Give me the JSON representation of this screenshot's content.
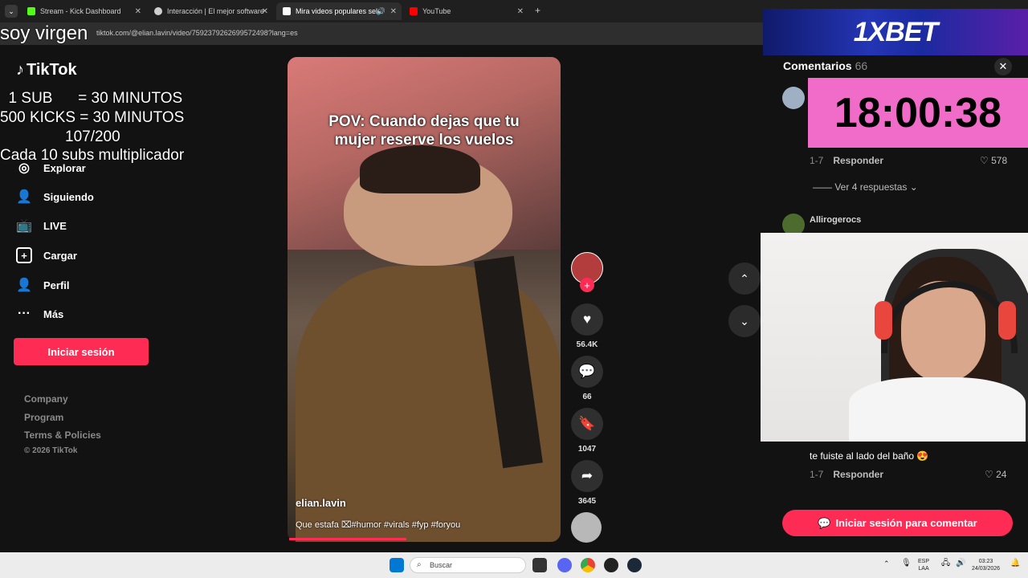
{
  "browser": {
    "tabs": [
      {
        "label": "Stream - Kick Dashboard",
        "icon": "kick-icon",
        "color": "#53fc18"
      },
      {
        "label": "Interacción | El mejor software",
        "icon": "globe-icon",
        "color": "#cfcfcf"
      },
      {
        "label": "Mira videos populares sele",
        "icon": "tiktok-icon",
        "color": "#ffffff"
      },
      {
        "label": "YouTube",
        "icon": "youtube-icon",
        "color": "#ff0000"
      }
    ],
    "new_tab": "+",
    "url": "tiktok.com/@elian.lavin/video/7592379262699572498?lang=es"
  },
  "overlay": {
    "line1": "soy virgen",
    "line2": "  1 SUB      = 30 MINUTOS",
    "line3": "500 KICKS = 30 MINUTOS",
    "line4": "107/200",
    "line5": "Cada 10 subs multiplicador"
  },
  "sidebar": {
    "logo": "TikTok",
    "items": [
      {
        "label": "Explorar",
        "icon": "compass-icon"
      },
      {
        "label": "Siguiendo",
        "icon": "following-icon"
      },
      {
        "label": "LIVE",
        "icon": "live-tv-icon"
      },
      {
        "label": "Cargar",
        "icon": "upload-plus-icon"
      },
      {
        "label": "Perfil",
        "icon": "profile-icon"
      },
      {
        "label": "Más",
        "icon": "more-dots-icon"
      }
    ],
    "login_button": "Iniciar sesión",
    "footer": [
      "Company",
      "Program",
      "Terms & Policies"
    ],
    "copyright": "© 2026 TikTok"
  },
  "video": {
    "caption_line1": "POV: Cuando dejas que tu",
    "caption_line2": "mujer reserve los vuelos",
    "author": "elian.lavin",
    "description": "Que estafa ⌧#humor #virals #fyp #foryou",
    "progress": 0.43
  },
  "actions": {
    "likes": "56.4K",
    "comments": "66",
    "saves": "1047",
    "shares": "3645",
    "follow": "+"
  },
  "comments_panel": {
    "title": "Comentarios",
    "count": "66",
    "items": [
      {
        "date": "1-7",
        "reply": "Responder",
        "likes": "578"
      },
      {
        "name": "Allirogerocs"
      },
      {
        "text": "te fuiste al lado del baño 😍",
        "date": "1-7",
        "reply": "Responder",
        "likes": "24"
      }
    ],
    "view_replies": "Ver 4 respuestas",
    "cta": "Iniciar sesión para comentar"
  },
  "stream_widgets": {
    "sponsor": "1XBET",
    "timer": "18:00:38"
  },
  "taskbar": {
    "search_placeholder": "Buscar",
    "lang_top": "ESP",
    "lang_bottom": "LAA",
    "time": "03:23",
    "date": "24/03/2026"
  },
  "colors": {
    "tiktok_accent": "#fe2c55",
    "timer_bg": "#f06cc8",
    "kick_green": "#53fc18"
  }
}
